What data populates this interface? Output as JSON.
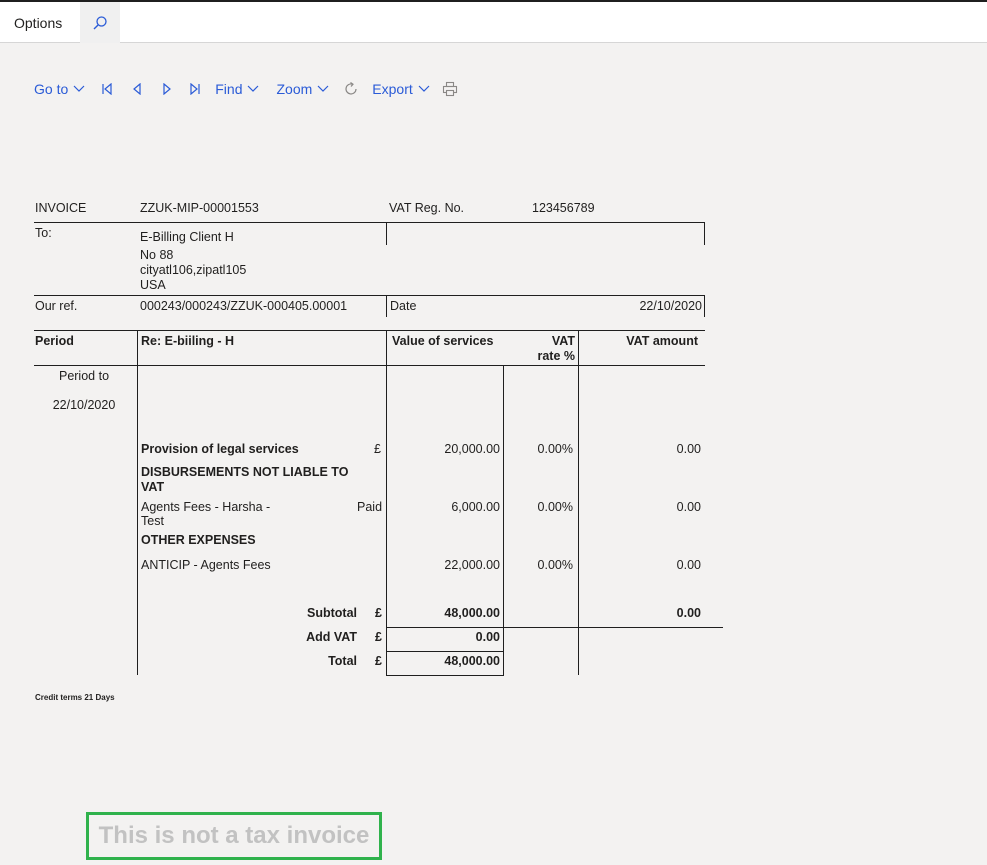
{
  "tabs": {
    "options_label": "Options"
  },
  "toolbar": {
    "goto_label": "Go to",
    "find_label": "Find",
    "zoom_label": "Zoom",
    "export_label": "Export"
  },
  "invoice": {
    "title": "INVOICE",
    "number": "ZZUK-MIP-00001553",
    "vat_reg_label": "VAT Reg. No.",
    "vat_reg_value": "123456789",
    "to_label": "To:",
    "client_name": "E-Billing Client H",
    "address_line1": "No 88",
    "address_line2": "cityatl106,zipatl105",
    "address_line3": "USA",
    "our_ref_label": "Our ref.",
    "our_ref_value": "000243/000243/ZZUK-000405.00001",
    "date_label": "Date",
    "date_value": "22/10/2020",
    "columns": {
      "period": "Period",
      "re": "Re: E-biiling - H",
      "value_of_services": "Value of services",
      "vat_rate_line1": "VAT",
      "vat_rate_line2": "rate %",
      "vat_amount": "VAT amount"
    },
    "period_to_label": "Period to",
    "period_to_value": "22/10/2020",
    "lines": {
      "legal": {
        "desc": "Provision of legal services",
        "currency": "£",
        "value": "20,000.00",
        "rate": "0.00%",
        "vat": "0.00"
      },
      "disb_header_line1": "DISBURSEMENTS NOT LIABLE TO",
      "disb_header_line2": "VAT",
      "agents": {
        "desc_line1": "Agents Fees - Harsha -",
        "desc_line2": "Test",
        "status": "Paid",
        "value": "6,000.00",
        "rate": "0.00%",
        "vat": "0.00"
      },
      "other_header": "OTHER EXPENSES",
      "anticip": {
        "desc": "ANTICIP - Agents Fees",
        "value": "22,000.00",
        "rate": "0.00%",
        "vat": "0.00"
      }
    },
    "subtotal_label": "Subtotal",
    "subtotal_currency": "£",
    "subtotal_value": "48,000.00",
    "subtotal_vat": "0.00",
    "add_vat_label": "Add VAT",
    "add_vat_currency": "£",
    "add_vat_value": "0.00",
    "total_label": "Total",
    "total_currency": "£",
    "total_value": "48,000.00",
    "credit_terms": "Credit terms 21 Days",
    "notice": "This is not a tax invoice"
  }
}
